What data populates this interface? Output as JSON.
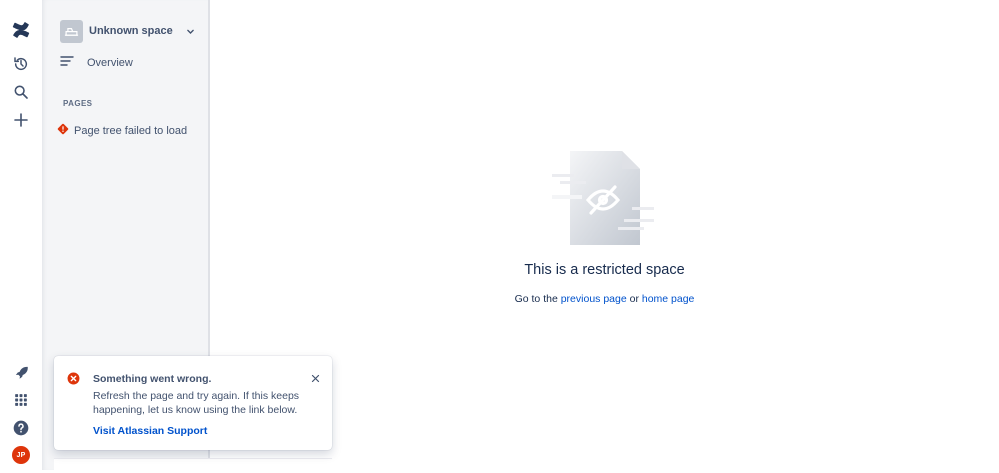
{
  "rail": {
    "logo_icon": "confluence-logo-icon",
    "icons": [
      "history-icon",
      "search-icon",
      "plus-icon",
      "rocket-icon",
      "app-switcher-icon",
      "help-icon"
    ],
    "avatar_initials": "JP",
    "avatar_color": "#de350b"
  },
  "sidebar": {
    "space_name": "Unknown space",
    "overview_label": "Overview",
    "pages_heading": "PAGES",
    "tree_error": "Page tree failed to load"
  },
  "main": {
    "title": "This is a restricted space",
    "subtitle_prefix": "Go to the ",
    "previous_link": "previous page",
    "subtitle_middle": " or ",
    "home_link": "home page"
  },
  "flag": {
    "title": "Something went wrong.",
    "body": "Refresh the page and try again. If this keeps happening, let us know using the link below.",
    "action": "Visit Atlassian Support",
    "error_color": "#de350b"
  },
  "colors": {
    "link": "#0052cc",
    "text": "#172b4d",
    "sidebar_bg": "#f4f5f7"
  }
}
